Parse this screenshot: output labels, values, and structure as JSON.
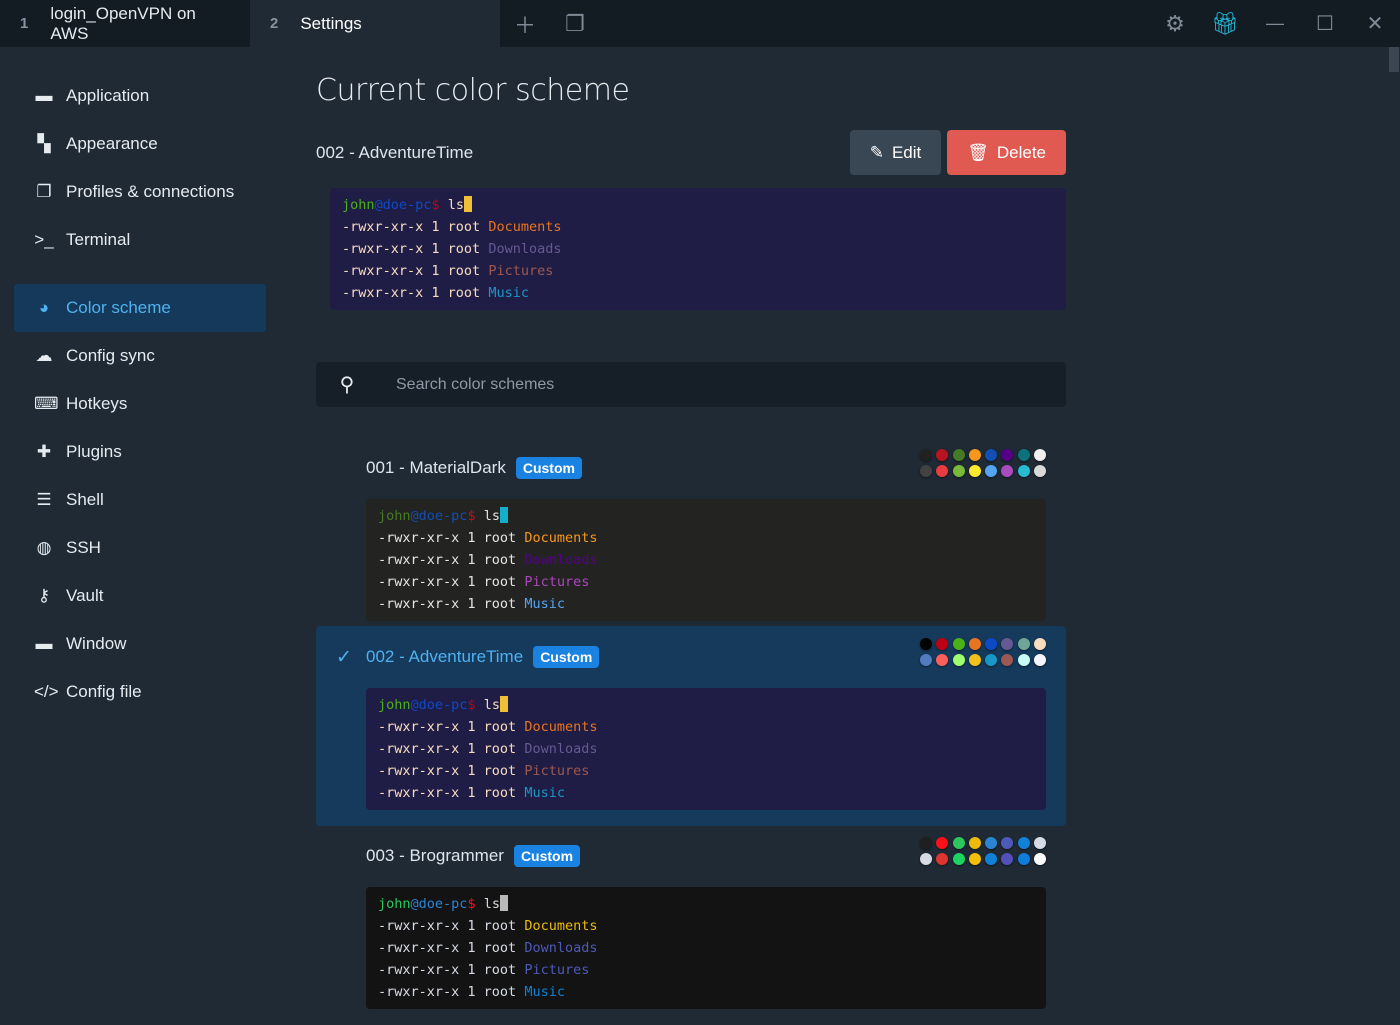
{
  "tabs": [
    {
      "num": "1",
      "label": "login_OpenVPN on AWS"
    },
    {
      "num": "2",
      "label": "Settings"
    }
  ],
  "sidebar": {
    "items": [
      {
        "label": "Application",
        "icon": "window-icon",
        "glyph": "▬"
      },
      {
        "label": "Appearance",
        "icon": "paint-icon",
        "glyph": "▚"
      },
      {
        "label": "Profiles & connections",
        "icon": "profiles-icon",
        "glyph": "❐"
      },
      {
        "label": "Terminal",
        "icon": "terminal-icon",
        "glyph": ">_"
      },
      {
        "label": "Color scheme",
        "icon": "palette-icon",
        "glyph": "◕"
      },
      {
        "label": "Config sync",
        "icon": "cloud-icon",
        "glyph": "☁"
      },
      {
        "label": "Hotkeys",
        "icon": "keyboard-icon",
        "glyph": "⌨"
      },
      {
        "label": "Plugins",
        "icon": "puzzle-icon",
        "glyph": "✚"
      },
      {
        "label": "Shell",
        "icon": "list-icon",
        "glyph": "☰"
      },
      {
        "label": "SSH",
        "icon": "globe-icon",
        "glyph": "◍"
      },
      {
        "label": "Vault",
        "icon": "key-icon",
        "glyph": "⚷"
      },
      {
        "label": "Window",
        "icon": "window-icon",
        "glyph": "▬"
      },
      {
        "label": "Config file",
        "icon": "code-icon",
        "glyph": "</>"
      }
    ],
    "active": 4
  },
  "main": {
    "title": "Current color scheme",
    "current": "002 - AdventureTime",
    "edit_label": "Edit",
    "delete_label": "Delete",
    "search_placeholder": "Search color schemes"
  },
  "terminal": {
    "user": "john",
    "at": "@",
    "host": "doe-pc",
    "dollar": "$",
    "cmd": " ls",
    "perm": "-rwxr-xr-x 1 root ",
    "files": [
      "Documents",
      "Downloads",
      "Pictures",
      "Music"
    ]
  },
  "schemes": [
    {
      "name": "001 - MaterialDark",
      "badge": "Custom",
      "selected": false,
      "bg": "#232322",
      "fg": "#e5e5e5",
      "user": "#457b24",
      "host": "#134eb2",
      "dollar": "#b7141f",
      "cursor": "#16afca",
      "files": [
        "#f6981e",
        "#560088",
        "#ab47bc",
        "#54a4f3"
      ],
      "colors": [
        "#212121",
        "#b7141f",
        "#457b24",
        "#f6981e",
        "#134eb2",
        "#560088",
        "#0e717c",
        "#efefef",
        "#424242",
        "#e83b3f",
        "#7aba3a",
        "#ffea2e",
        "#54a4f3",
        "#aa4dbc",
        "#26bbd1",
        "#d9d9d9"
      ]
    },
    {
      "name": "002 - AdventureTime",
      "badge": "Custom",
      "selected": true,
      "bg": "#1f1d45",
      "fg": "#f8dcc0",
      "user": "#4ab118",
      "host": "#0f4ac6",
      "dollar": "#bd0013",
      "cursor": "#efbf38",
      "files": [
        "#e7741e",
        "#665993",
        "#9d584f",
        "#1997c6"
      ],
      "colors": [
        "#050404",
        "#bd0013",
        "#4ab118",
        "#e7741e",
        "#0f4ac6",
        "#665993",
        "#70a598",
        "#f8dcc0",
        "#4e7cbf",
        "#fc5f5a",
        "#9eff6e",
        "#efc11a",
        "#1997c6",
        "#9b5953",
        "#c8faf4",
        "#f6f5fb"
      ]
    },
    {
      "name": "003 - Brogrammer",
      "badge": "Custom",
      "selected": false,
      "bg": "#131313",
      "fg": "#d6dbe5",
      "user": "#2dc55e",
      "host": "#2a84d2",
      "dollar": "#f81118",
      "cursor": "#b9b9b9",
      "files": [
        "#ecba0f",
        "#4e5ab7",
        "#4e5ab7",
        "#1081d6"
      ],
      "colors": [
        "#1f1f1f",
        "#f81118",
        "#2dc55e",
        "#ecba0f",
        "#2a84d2",
        "#4e5ab7",
        "#1081d6",
        "#d6dbe5",
        "#d6dbe5",
        "#de352e",
        "#1dd361",
        "#f3bd09",
        "#1081d6",
        "#5350b9",
        "#0f7ddb",
        "#ffffff"
      ]
    }
  ],
  "current_preview": 1
}
